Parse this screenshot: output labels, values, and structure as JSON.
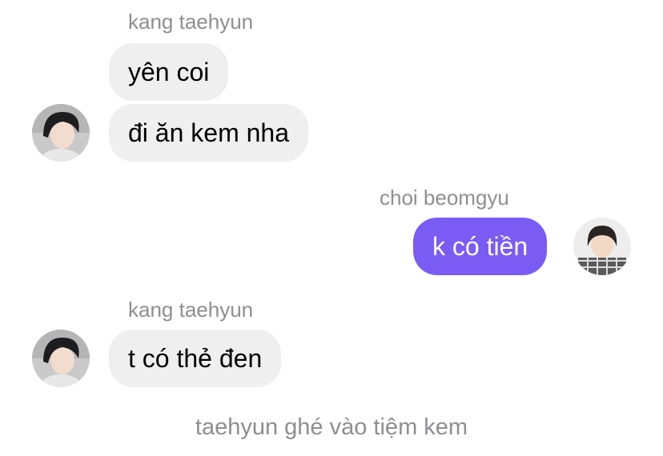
{
  "messages": [
    {
      "sender": "kang taehyun",
      "texts": [
        "yên coi",
        "đi ăn kem nha"
      ]
    },
    {
      "sender": "choi beomgyu",
      "texts": [
        "k có tiền"
      ]
    },
    {
      "sender": "kang taehyun",
      "texts": [
        "t có thẻ đen"
      ]
    }
  ],
  "system_note": "taehyun ghé vào tiệm kem",
  "colors": {
    "incoming_bubble": "#efefef",
    "outgoing_bubble": "#7a5cf5",
    "name_text": "#8e8e93"
  }
}
